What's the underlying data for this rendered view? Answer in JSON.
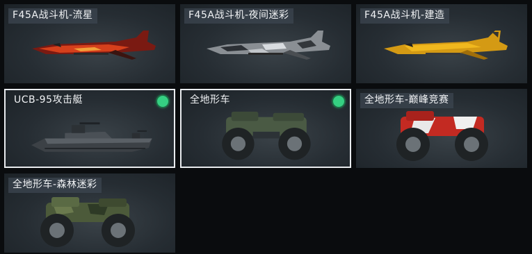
{
  "items": [
    {
      "label": "F45A战斗机-流星",
      "selected": false,
      "equipped": false,
      "icon": "jet-red"
    },
    {
      "label": "F45A战斗机-夜间迷彩",
      "selected": false,
      "equipped": false,
      "icon": "jet-camo"
    },
    {
      "label": "F45A战斗机-建造",
      "selected": false,
      "equipped": false,
      "icon": "jet-yellow"
    },
    {
      "label": "UCB-95攻击艇",
      "selected": true,
      "equipped": true,
      "icon": "boat"
    },
    {
      "label": "全地形车",
      "selected": true,
      "equipped": true,
      "icon": "atv-green"
    },
    {
      "label": "全地形车-巅峰竞赛",
      "selected": false,
      "equipped": false,
      "icon": "atv-red"
    },
    {
      "label": "全地形车-森林迷彩",
      "selected": false,
      "equipped": false,
      "icon": "atv-forest"
    }
  ],
  "colors": {
    "background": "#0a0c0e",
    "card": "#262d33",
    "selected_border": "#e9ecef",
    "equipped_badge": "#35d082"
  }
}
